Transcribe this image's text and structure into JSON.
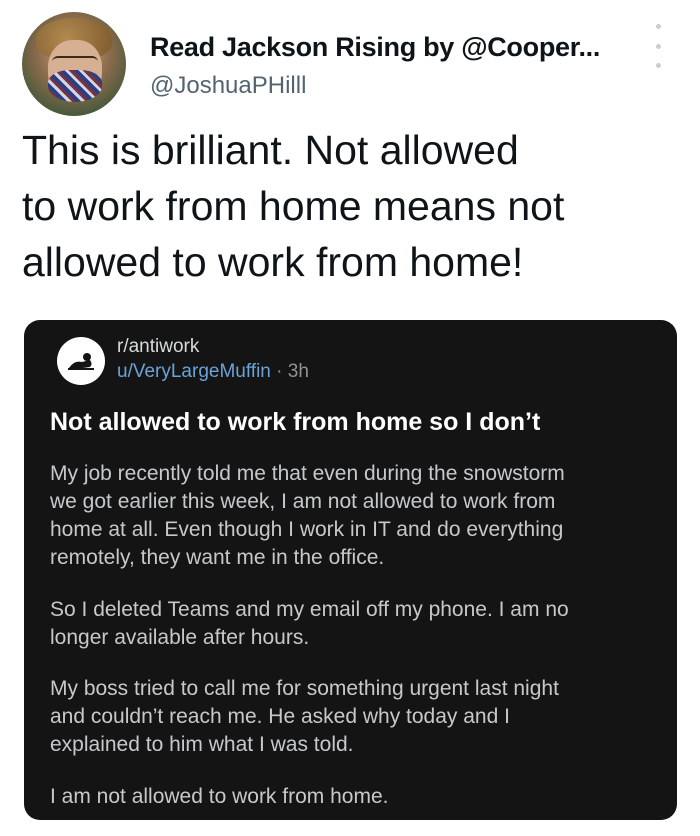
{
  "tweet": {
    "display_name": "Read Jackson Rising by @Cooper...",
    "handle": "@JoshuaPHilll",
    "text_lines": [
      "This is brilliant. Not allowed",
      "to work from home means not",
      "allowed to work from home!"
    ]
  },
  "post": {
    "subreddit": "r/antiwork",
    "user": "u/VeryLargeMuffin",
    "separator": "·",
    "age": "3h",
    "title": "Not allowed to work from home so I don’t",
    "paragraphs": [
      [
        "My job recently told me that even during the snowstorm",
        "we got earlier this week, I am not allowed to work from",
        "home at all. Even though I work in IT and do everything",
        "remotely, they want me in the office."
      ],
      [
        "So I deleted Teams and my email off my phone. I am no",
        "longer available after hours."
      ],
      [
        "My boss tried to call me for something urgent last night",
        "and couldn’t reach me. He asked why today and I",
        "explained to him what I was told."
      ],
      [
        "I am not allowed to work from home."
      ]
    ]
  },
  "icons": {
    "avatar": "profile-photo",
    "more": "more-options-icon",
    "subreddit_icon": "subreddit-avatar-icon"
  },
  "colors": {
    "card_bg": "#141414",
    "username_link": "#6aa3d9",
    "handle_gray": "#536471"
  }
}
